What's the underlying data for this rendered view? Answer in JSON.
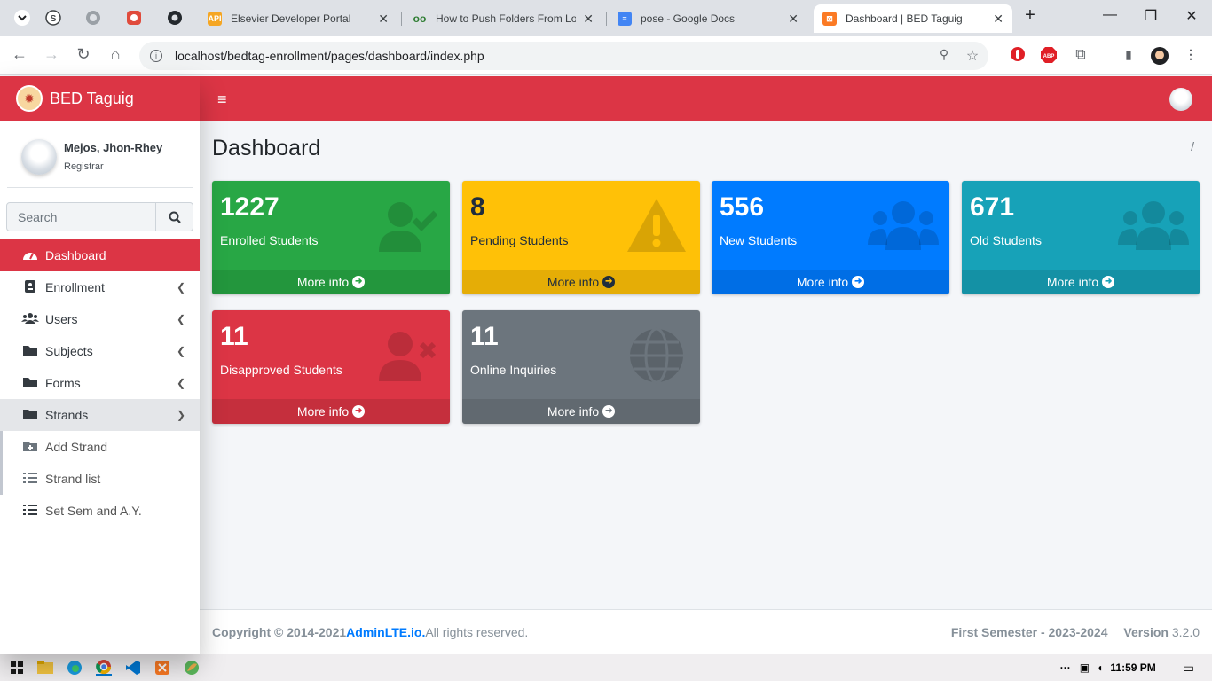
{
  "browser": {
    "tabs": [
      {
        "title": "Elsevier Developer Portal",
        "fav": "API",
        "color": "#f5a623"
      },
      {
        "title": "How to Push Folders From Lo",
        "fav": "oo",
        "color": "#2e7d32"
      },
      {
        "title": "pose - Google Docs",
        "fav": "≡",
        "color": "#4285f4"
      },
      {
        "title": "Dashboard | BED Taguig",
        "fav": "⊠",
        "color": "#fb7a24"
      }
    ],
    "url": "localhost/bedtag-enrollment/pages/dashboard/index.php"
  },
  "brand": {
    "name": "BED Taguig"
  },
  "user": {
    "name": "Mejos, Jhon-Rhey",
    "role": "Registrar"
  },
  "sidebar": {
    "search_placeholder": "Search",
    "items": [
      {
        "label": "Dashboard",
        "icon": "tachometer-icon"
      },
      {
        "label": "Enrollment",
        "icon": "id-card-icon"
      },
      {
        "label": "Users",
        "icon": "users-icon"
      },
      {
        "label": "Subjects",
        "icon": "folder-icon"
      },
      {
        "label": "Forms",
        "icon": "folder-icon"
      },
      {
        "label": "Strands",
        "icon": "folder-icon"
      },
      {
        "label": "Add Strand",
        "icon": "folder-plus-icon"
      },
      {
        "label": "Strand list",
        "icon": "list-icon"
      },
      {
        "label": "Set Sem and A.Y.",
        "icon": "list-icon"
      }
    ]
  },
  "page": {
    "title": "Dashboard",
    "breadcrumb": "/"
  },
  "boxes": [
    {
      "value": "1227",
      "label": "Enrolled Students",
      "more": "More info",
      "color": "#28a745",
      "icon": "user-check-icon"
    },
    {
      "value": "8",
      "label": "Pending Students",
      "more": "More info",
      "color": "#ffc107",
      "icon": "warning-icon"
    },
    {
      "value": "556",
      "label": "New Students",
      "more": "More info",
      "color": "#007bff",
      "icon": "users-icon"
    },
    {
      "value": "671",
      "label": "Old Students",
      "more": "More info",
      "color": "#17a2b8",
      "icon": "users-icon"
    },
    {
      "value": "11",
      "label": "Disapproved Students",
      "more": "More info",
      "color": "#dc3545",
      "icon": "user-times-icon"
    },
    {
      "value": "11",
      "label": "Online Inquiries",
      "more": "More info",
      "color": "#6c757d",
      "icon": "globe-icon"
    }
  ],
  "footer": {
    "copyright": "Copyright © 2014-2021 ",
    "link": "AdminLTE.io.",
    "rights": " All rights reserved.",
    "semester": "First Semester - 2023-2024",
    "version_label": "Version",
    "version": "3.2.0"
  },
  "taskbar": {
    "time": "11:59 PM"
  }
}
